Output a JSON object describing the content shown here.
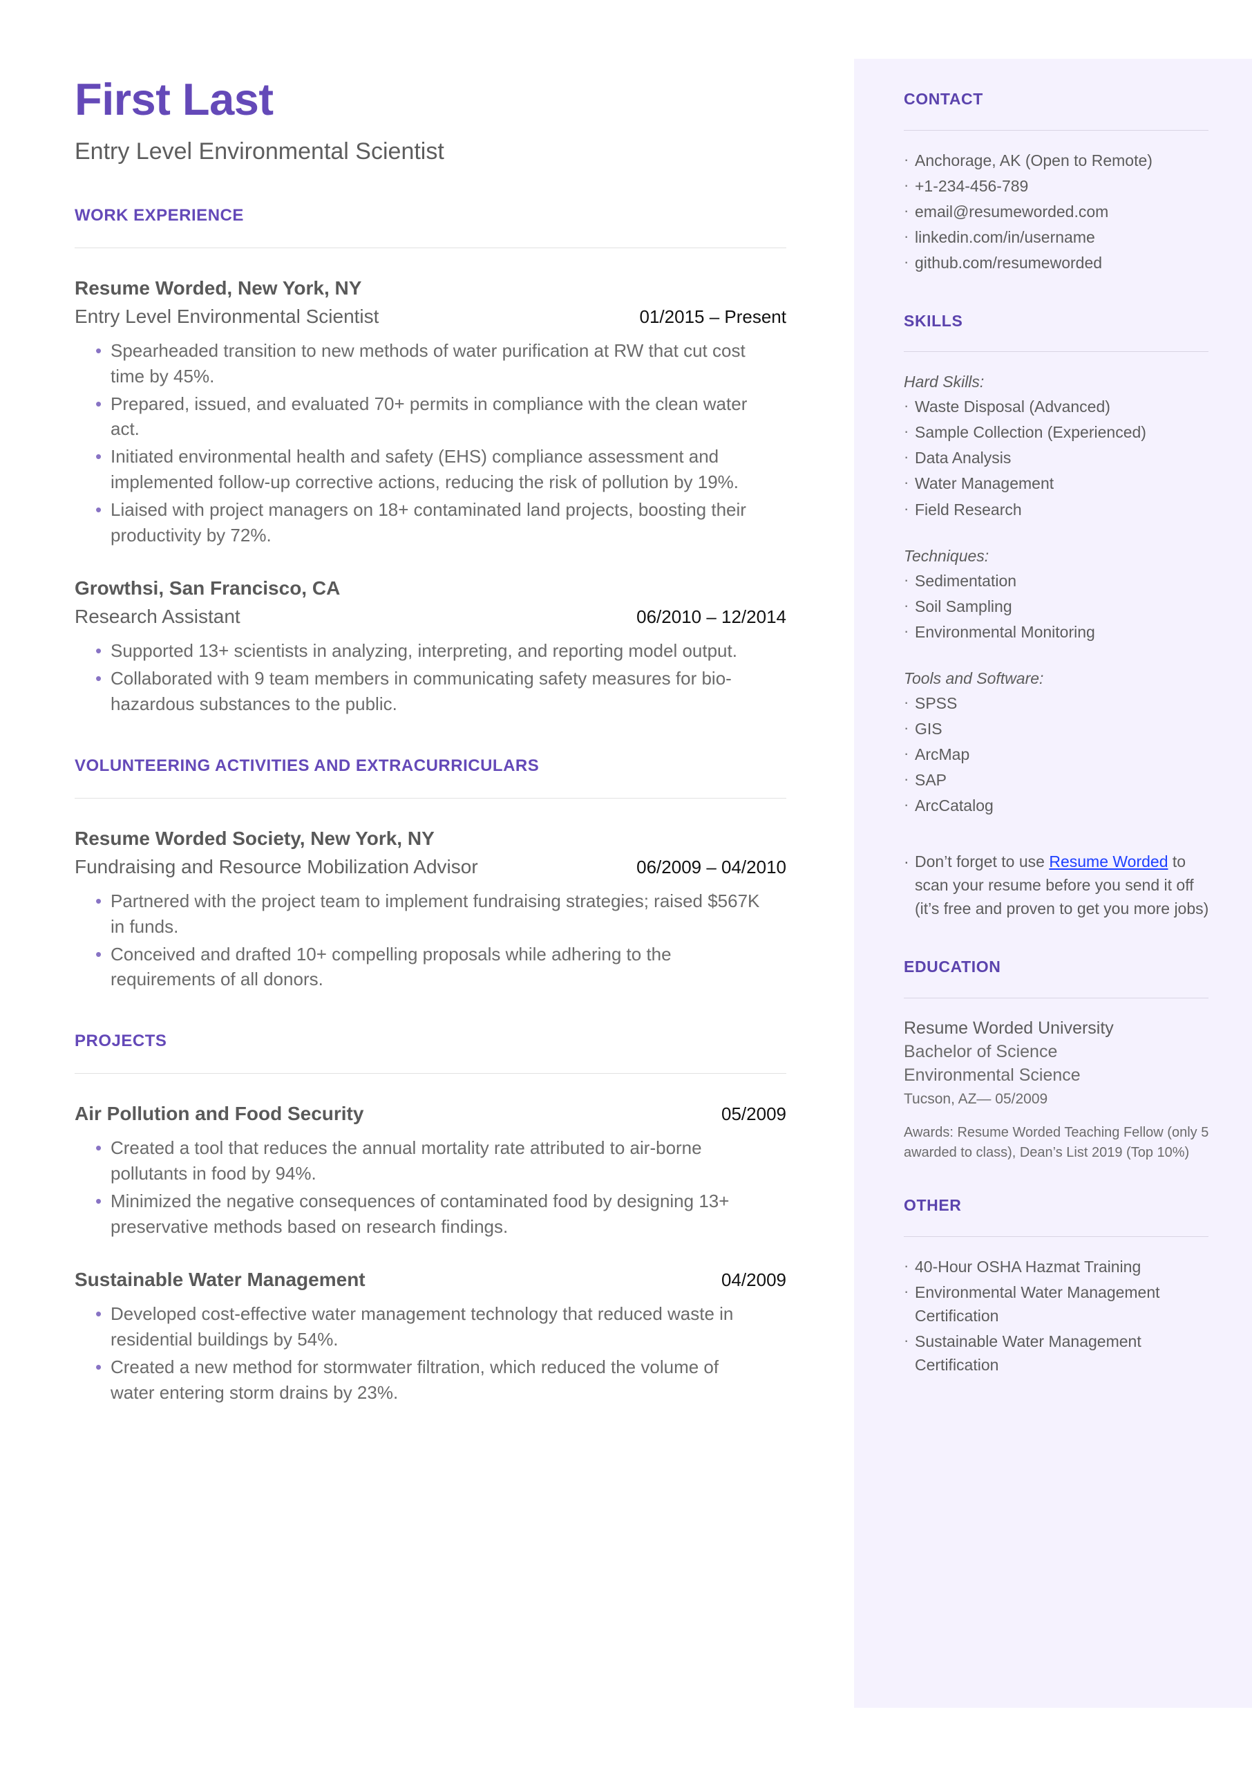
{
  "header": {
    "name": "First Last",
    "headline": "Entry Level Environmental Scientist"
  },
  "main": {
    "work": {
      "heading": "WORK EXPERIENCE",
      "entries": [
        {
          "org": "Resume Worded, New York, NY",
          "role": "Entry Level Environmental Scientist",
          "date": "01/2015 – Present",
          "bullets": [
            "Spearheaded transition to new methods of water purification at RW that cut cost time by 45%.",
            "Prepared, issued, and evaluated 70+ permits in compliance with the clean water act.",
            "Initiated environmental health and safety (EHS) compliance assessment and implemented follow-up corrective actions, reducing the risk of pollution by 19%.",
            "Liaised with project managers on 18+  contaminated land projects, boosting their productivity by 72%."
          ]
        },
        {
          "org": "Growthsi, San Francisco, CA",
          "role": "Research Assistant",
          "date": "06/2010 – 12/2014",
          "bullets": [
            "Supported 13+ scientists in analyzing, interpreting, and reporting model output.",
            "Collaborated with 9 team members in communicating safety measures for bio-hazardous substances to the public."
          ]
        }
      ]
    },
    "volunteering": {
      "heading": "VOLUNTEERING ACTIVITIES AND EXTRACURRICULARS",
      "entries": [
        {
          "org": "Resume Worded Society, New York, NY",
          "role": "Fundraising and Resource Mobilization Advisor",
          "date": "06/2009 – 04/2010",
          "bullets": [
            "Partnered with the project team to implement fundraising strategies; raised $567K in funds.",
            "Conceived and drafted 10+ compelling proposals while adhering to the requirements of all donors."
          ]
        }
      ]
    },
    "projects": {
      "heading": "PROJECTS",
      "entries": [
        {
          "title": "Air Pollution and Food Security",
          "date": "05/2009",
          "bullets": [
            "Created a tool that reduces the annual mortality rate attributed to air-borne pollutants in food by 94%.",
            "Minimized the negative consequences of contaminated food by designing 13+ preservative methods based on research findings."
          ]
        },
        {
          "title": "Sustainable Water Management",
          "date": "04/2009",
          "bullets": [
            "Developed cost-effective water management technology that reduced waste in residential buildings by 54%.",
            "Created a new method for stormwater filtration, which reduced the volume of water entering storm drains by 23%."
          ]
        }
      ]
    }
  },
  "sidebar": {
    "contact": {
      "heading": "CONTACT",
      "items": [
        " Anchorage, AK (Open to Remote)",
        "+1-234-456-789",
        "email@resumeworded.com",
        "linkedin.com/in/username",
        "github.com/resumeworded"
      ]
    },
    "skills": {
      "heading": "SKILLS",
      "groups": [
        {
          "label": "Hard Skills:",
          "items": [
            "Waste Disposal  (Advanced)",
            "Sample Collection  (Experienced)",
            "Data Analysis",
            "Water Management",
            "Field Research"
          ]
        },
        {
          "label": "Techniques:",
          "items": [
            "Sedimentation",
            "Soil Sampling",
            "Environmental Monitoring"
          ]
        },
        {
          "label": "Tools and Software:",
          "items": [
            "SPSS",
            "GIS",
            "ArcMap",
            "SAP",
            "ArcCatalog"
          ]
        }
      ],
      "note": {
        "before": "Don’t forget to use ",
        "link": "Resume Worded",
        "after": " to scan your resume before you send it off (it’s free and proven to get you more jobs)"
      }
    },
    "education": {
      "heading": "EDUCATION",
      "school": "Resume Worded University",
      "degree_line1": "Bachelor of Science",
      "degree_line2": "Environmental Science",
      "location_date": "Tucson, AZ— 05/2009",
      "awards": "Awards: Resume Worded Teaching Fellow (only 5 awarded to class), Dean’s List 2019 (Top 10%)"
    },
    "other": {
      "heading": "OTHER",
      "items": [
        "40-Hour OSHA Hazmat Training",
        "Environmental Water Management Certification",
        "Sustainable Water Management Certification"
      ]
    }
  },
  "colors": {
    "accent_purple": "#6449b8",
    "sidebar_heading": "#5b43ad",
    "sidebar_bg": "#f5f2fe",
    "bullet_purple": "#8873c4",
    "link_blue": "#1e40ff",
    "body_text": "#6b6b6b"
  },
  "icons": {
    "bullet": "•",
    "side_bullet": "·"
  }
}
